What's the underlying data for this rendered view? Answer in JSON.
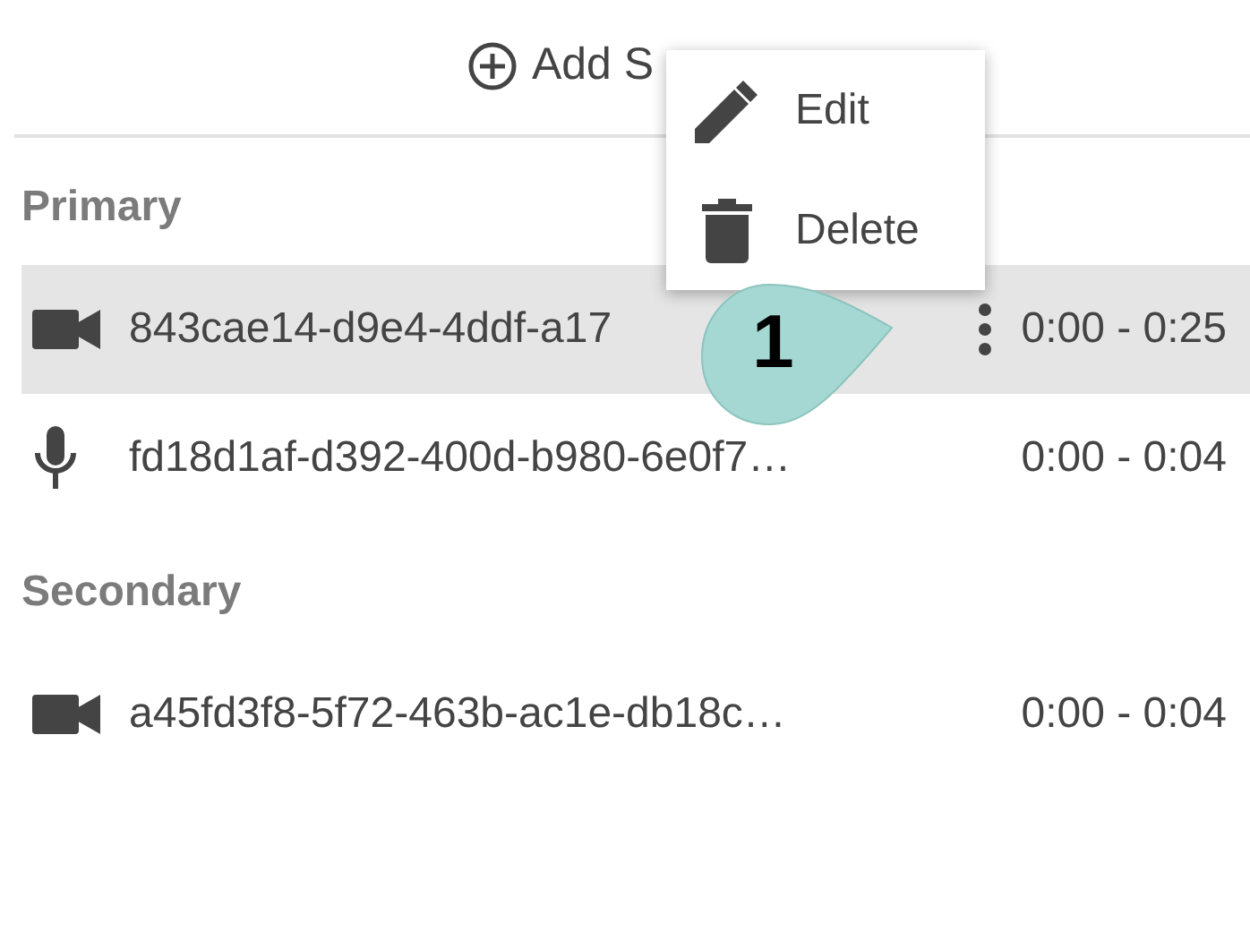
{
  "header": {
    "add_label": "Add S"
  },
  "sections": [
    {
      "title": "Primary",
      "items": [
        {
          "kind": "video",
          "name": "843cae14-d9e4-4ddf-a17",
          "time": "0:00 - 0:25",
          "selected": true,
          "show_actions": true
        },
        {
          "kind": "audio",
          "name": "fd18d1af-d392-400d-b980-6e0f7…",
          "time": "0:00 - 0:04",
          "selected": false,
          "show_actions": false
        }
      ]
    },
    {
      "title": "Secondary",
      "items": [
        {
          "kind": "video",
          "name": "a45fd3f8-5f72-463b-ac1e-db18c…",
          "time": "0:00 - 0:04",
          "selected": false,
          "show_actions": false
        }
      ]
    }
  ],
  "menu": {
    "items": [
      {
        "kind": "edit",
        "label": "Edit"
      },
      {
        "kind": "delete",
        "label": "Delete"
      }
    ]
  },
  "callout": {
    "label": "1"
  }
}
